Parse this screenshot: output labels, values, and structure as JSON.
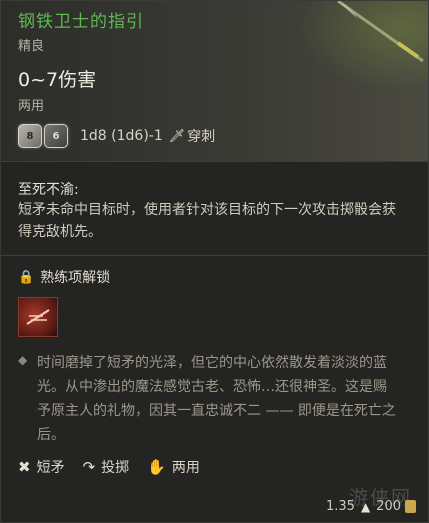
{
  "item": {
    "name": "钢铁卫士的指引",
    "rarity": "精良",
    "damage": "0~7伤害",
    "handedness": "两用",
    "dice": {
      "die1": "8",
      "die2": "6",
      "formula": "1d8 (1d6)-1",
      "damage_type_icon": "dagger-icon",
      "damage_type": "穿刺"
    }
  },
  "passive": {
    "title": "至死不渝:",
    "description": "短矛未命中目标时，使用者针对该目标的下一次攻击掷骰会获得克敌机先。"
  },
  "proficiency": {
    "label": "熟练项解锁",
    "icon": "lock-icon"
  },
  "lore": "时间磨掉了短矛的光泽，但它的中心依然散发着淡淡的蓝光。从中渗出的魔法感觉古老、恐怖…还很神圣。这是赐予原主人的礼物，因其一直忠诚不二 —— 即便是在死亡之后。",
  "tags": [
    {
      "icon": "crossed-weapons-icon",
      "label": "短矛"
    },
    {
      "icon": "throw-icon",
      "label": "投掷"
    },
    {
      "icon": "hand-icon",
      "label": "两用"
    }
  ],
  "footer": {
    "weight": "1.35",
    "value": "200"
  },
  "watermark": "游侠网",
  "colors": {
    "title": "#5dbb52",
    "background": "#242422"
  }
}
